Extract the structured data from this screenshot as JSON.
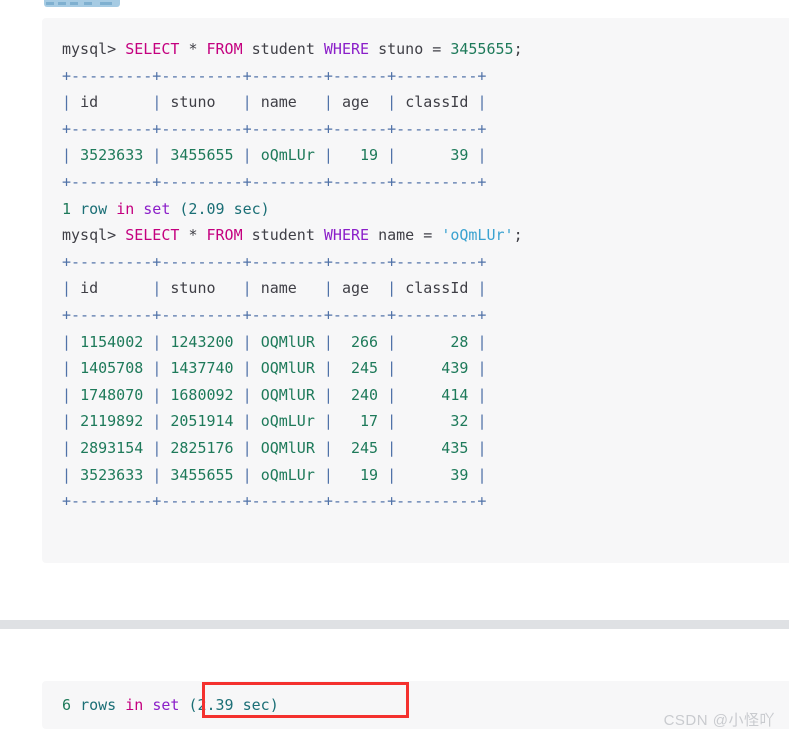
{
  "toolbar": {
    "dashes": [
      2,
      14,
      26,
      40,
      56
    ]
  },
  "code_block_main": {
    "lines": [
      [
        {
          "t": "mysql> ",
          "c": "tok-prompt"
        },
        {
          "t": "SELECT ",
          "c": "tok-kw-pink"
        },
        {
          "t": "* ",
          "c": "tok-plain"
        },
        {
          "t": "FROM ",
          "c": "tok-kw-pink"
        },
        {
          "t": "student ",
          "c": "tok-plain"
        },
        {
          "t": "WHERE ",
          "c": "tok-kw-purp"
        },
        {
          "t": "stuno = ",
          "c": "tok-plain"
        },
        {
          "t": "3455655",
          "c": "tok-num"
        },
        {
          "t": ";",
          "c": "tok-plain"
        }
      ],
      [
        {
          "t": "+---------+---------+--------+------+---------+",
          "c": "tok-border"
        }
      ],
      [
        {
          "t": "| ",
          "c": "tok-border"
        },
        {
          "t": "id      ",
          "c": "tok-head"
        },
        {
          "t": "| ",
          "c": "tok-border"
        },
        {
          "t": "stuno   ",
          "c": "tok-head"
        },
        {
          "t": "| ",
          "c": "tok-border"
        },
        {
          "t": "name   ",
          "c": "tok-head"
        },
        {
          "t": "| ",
          "c": "tok-border"
        },
        {
          "t": "age  ",
          "c": "tok-head"
        },
        {
          "t": "| ",
          "c": "tok-border"
        },
        {
          "t": "classId ",
          "c": "tok-head"
        },
        {
          "t": "|",
          "c": "tok-border"
        }
      ],
      [
        {
          "t": "+---------+---------+--------+------+---------+",
          "c": "tok-border"
        }
      ],
      [
        {
          "t": "| ",
          "c": "tok-border"
        },
        {
          "t": "3523633 ",
          "c": "tok-green"
        },
        {
          "t": "| ",
          "c": "tok-border"
        },
        {
          "t": "3455655 ",
          "c": "tok-green"
        },
        {
          "t": "| ",
          "c": "tok-border"
        },
        {
          "t": "oQmLUr ",
          "c": "tok-green"
        },
        {
          "t": "| ",
          "c": "tok-border"
        },
        {
          "t": "  19 ",
          "c": "tok-green"
        },
        {
          "t": "| ",
          "c": "tok-border"
        },
        {
          "t": "     39 ",
          "c": "tok-green"
        },
        {
          "t": "|",
          "c": "tok-border"
        }
      ],
      [
        {
          "t": "+---------+---------+--------+------+---------+",
          "c": "tok-border"
        }
      ],
      [
        {
          "t": "1 ",
          "c": "tok-green"
        },
        {
          "t": "row ",
          "c": "tok-teal"
        },
        {
          "t": "in ",
          "c": "tok-kw-pink"
        },
        {
          "t": "set ",
          "c": "tok-kw-purp"
        },
        {
          "t": "(2.09 sec)",
          "c": "tok-teal"
        }
      ],
      [
        {
          "t": "mysql> ",
          "c": "tok-prompt"
        },
        {
          "t": "SELECT ",
          "c": "tok-kw-pink"
        },
        {
          "t": "* ",
          "c": "tok-plain"
        },
        {
          "t": "FROM ",
          "c": "tok-kw-pink"
        },
        {
          "t": "student ",
          "c": "tok-plain"
        },
        {
          "t": "WHERE ",
          "c": "tok-kw-purp"
        },
        {
          "t": "name = ",
          "c": "tok-plain"
        },
        {
          "t": "'oQmLUr'",
          "c": "tok-str"
        },
        {
          "t": ";",
          "c": "tok-plain"
        }
      ],
      [
        {
          "t": "+---------+---------+--------+------+---------+",
          "c": "tok-border"
        }
      ],
      [
        {
          "t": "| ",
          "c": "tok-border"
        },
        {
          "t": "id      ",
          "c": "tok-head"
        },
        {
          "t": "| ",
          "c": "tok-border"
        },
        {
          "t": "stuno   ",
          "c": "tok-head"
        },
        {
          "t": "| ",
          "c": "tok-border"
        },
        {
          "t": "name   ",
          "c": "tok-head"
        },
        {
          "t": "| ",
          "c": "tok-border"
        },
        {
          "t": "age  ",
          "c": "tok-head"
        },
        {
          "t": "| ",
          "c": "tok-border"
        },
        {
          "t": "classId ",
          "c": "tok-head"
        },
        {
          "t": "|",
          "c": "tok-border"
        }
      ],
      [
        {
          "t": "+---------+---------+--------+------+---------+",
          "c": "tok-border"
        }
      ],
      [
        {
          "t": "| ",
          "c": "tok-border"
        },
        {
          "t": "1154002 ",
          "c": "tok-green"
        },
        {
          "t": "| ",
          "c": "tok-border"
        },
        {
          "t": "1243200 ",
          "c": "tok-green"
        },
        {
          "t": "| ",
          "c": "tok-border"
        },
        {
          "t": "OQMlUR ",
          "c": "tok-green"
        },
        {
          "t": "| ",
          "c": "tok-border"
        },
        {
          "t": " 266 ",
          "c": "tok-green"
        },
        {
          "t": "| ",
          "c": "tok-border"
        },
        {
          "t": "     28 ",
          "c": "tok-green"
        },
        {
          "t": "|",
          "c": "tok-border"
        }
      ],
      [
        {
          "t": "| ",
          "c": "tok-border"
        },
        {
          "t": "1405708 ",
          "c": "tok-green"
        },
        {
          "t": "| ",
          "c": "tok-border"
        },
        {
          "t": "1437740 ",
          "c": "tok-green"
        },
        {
          "t": "| ",
          "c": "tok-border"
        },
        {
          "t": "OQMlUR ",
          "c": "tok-green"
        },
        {
          "t": "| ",
          "c": "tok-border"
        },
        {
          "t": " 245 ",
          "c": "tok-green"
        },
        {
          "t": "| ",
          "c": "tok-border"
        },
        {
          "t": "    439 ",
          "c": "tok-green"
        },
        {
          "t": "|",
          "c": "tok-border"
        }
      ],
      [
        {
          "t": "| ",
          "c": "tok-border"
        },
        {
          "t": "1748070 ",
          "c": "tok-green"
        },
        {
          "t": "| ",
          "c": "tok-border"
        },
        {
          "t": "1680092 ",
          "c": "tok-green"
        },
        {
          "t": "| ",
          "c": "tok-border"
        },
        {
          "t": "OQMlUR ",
          "c": "tok-green"
        },
        {
          "t": "| ",
          "c": "tok-border"
        },
        {
          "t": " 240 ",
          "c": "tok-green"
        },
        {
          "t": "| ",
          "c": "tok-border"
        },
        {
          "t": "    414 ",
          "c": "tok-green"
        },
        {
          "t": "|",
          "c": "tok-border"
        }
      ],
      [
        {
          "t": "| ",
          "c": "tok-border"
        },
        {
          "t": "2119892 ",
          "c": "tok-green"
        },
        {
          "t": "| ",
          "c": "tok-border"
        },
        {
          "t": "2051914 ",
          "c": "tok-green"
        },
        {
          "t": "| ",
          "c": "tok-border"
        },
        {
          "t": "oQmLUr ",
          "c": "tok-green"
        },
        {
          "t": "| ",
          "c": "tok-border"
        },
        {
          "t": "  17 ",
          "c": "tok-green"
        },
        {
          "t": "| ",
          "c": "tok-border"
        },
        {
          "t": "     32 ",
          "c": "tok-green"
        },
        {
          "t": "|",
          "c": "tok-border"
        }
      ],
      [
        {
          "t": "| ",
          "c": "tok-border"
        },
        {
          "t": "2893154 ",
          "c": "tok-green"
        },
        {
          "t": "| ",
          "c": "tok-border"
        },
        {
          "t": "2825176 ",
          "c": "tok-green"
        },
        {
          "t": "| ",
          "c": "tok-border"
        },
        {
          "t": "OQMlUR ",
          "c": "tok-green"
        },
        {
          "t": "| ",
          "c": "tok-border"
        },
        {
          "t": " 245 ",
          "c": "tok-green"
        },
        {
          "t": "| ",
          "c": "tok-border"
        },
        {
          "t": "    435 ",
          "c": "tok-green"
        },
        {
          "t": "|",
          "c": "tok-border"
        }
      ],
      [
        {
          "t": "| ",
          "c": "tok-border"
        },
        {
          "t": "3523633 ",
          "c": "tok-green"
        },
        {
          "t": "| ",
          "c": "tok-border"
        },
        {
          "t": "3455655 ",
          "c": "tok-green"
        },
        {
          "t": "| ",
          "c": "tok-border"
        },
        {
          "t": "oQmLUr ",
          "c": "tok-green"
        },
        {
          "t": "| ",
          "c": "tok-border"
        },
        {
          "t": "  19 ",
          "c": "tok-green"
        },
        {
          "t": "| ",
          "c": "tok-border"
        },
        {
          "t": "     39 ",
          "c": "tok-green"
        },
        {
          "t": "|",
          "c": "tok-border"
        }
      ],
      [
        {
          "t": "+---------+---------+--------+------+---------+",
          "c": "tok-border"
        }
      ]
    ]
  },
  "code_block_footer": {
    "lines": [
      [
        {
          "t": "6 ",
          "c": "tok-green"
        },
        {
          "t": "rows ",
          "c": "tok-teal"
        },
        {
          "t": "in ",
          "c": "tok-kw-pink"
        },
        {
          "t": "set ",
          "c": "tok-kw-purp"
        },
        {
          "t": "(2.39 sec)",
          "c": "tok-teal"
        }
      ]
    ]
  },
  "annotation": {
    "color": "#f4312e",
    "target_text": "(2.39 sec)"
  },
  "watermark": {
    "text": "CSDN @小怪吖"
  },
  "colors": {
    "code_bg": "#f7f7f8",
    "divider": "#dfe1e4",
    "keyword_pink": "#c4007f",
    "keyword_purple": "#8b1fc9",
    "number_green": "#1e7a5a",
    "string_blue": "#3aa2d0",
    "table_border": "#5072a8",
    "annotation_red": "#f4312e",
    "watermark_gray": "#c9cbcf",
    "toolbar_blue": "#a6cbe3"
  }
}
